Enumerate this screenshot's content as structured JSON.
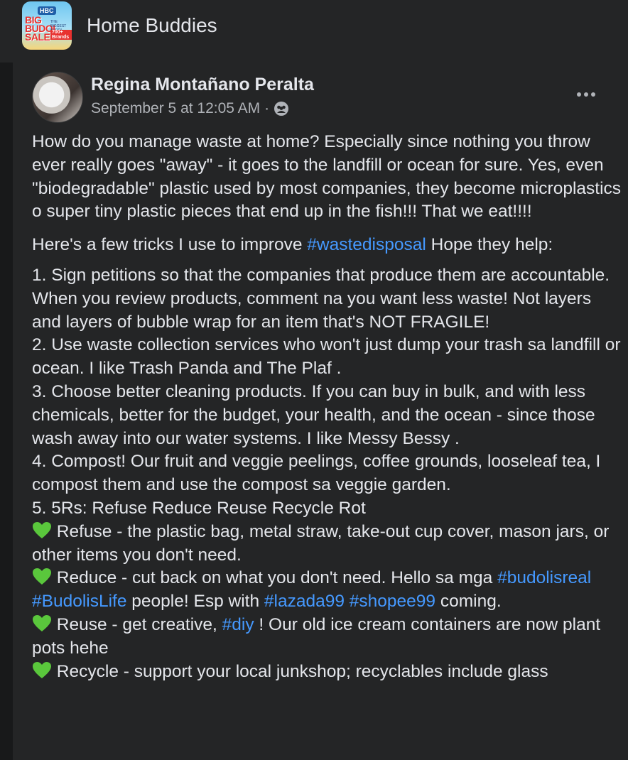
{
  "group": {
    "name": "Home Buddies",
    "thumbnail": {
      "logo": "HBC",
      "title": "BIG BUDOL SALE",
      "subtitle": "THE BIGGEST BUDOL SALE",
      "brands": "700+ Brands"
    }
  },
  "post": {
    "author": "Regina Montañano Peralta",
    "timestamp": "September 5 at 12:05 AM",
    "separator": "·",
    "audience_icon": "group-audience-icon",
    "more_icon": "more-options-icon",
    "intro": "How do you manage waste at home? Especially since nothing you throw ever really goes \"away\" - it goes to the landfill or ocean for sure. Yes, even \"biodegradable\" plastic used by most companies, they become microplastics o super tiny plastic pieces that end up in the fish!!! That we eat!!!!",
    "tricks_pre": "Here's a few tricks I use to improve ",
    "tricks_tag": "#wastedisposal",
    "tricks_post": "  Hope they help:",
    "item1": "1. Sign petitions so that the companies that produce them are accountable. When you review products, comment na you want less waste! Not layers and layers of bubble wrap for an item that's NOT FRAGILE!",
    "item2": "2. Use waste collection services who won't just dump your trash sa landfill or ocean. I like Trash Panda and The Plaf .",
    "item3": "3. Choose better cleaning products. If you can buy in bulk, and with less chemicals, better for the budget, your health, and the ocean - since those wash away into our water systems. I like Messy Bessy .",
    "item4": "4. Compost! Our fruit and veggie peelings, coffee grounds, looseleaf tea, I compost them and use the compost sa veggie garden.",
    "item5": "5. 5Rs: Refuse Reduce Reuse Recycle Rot",
    "refuse": " Refuse - the plastic bag, metal straw, take-out cup cover, mason jars, or other items you don't need.",
    "reduce_pre": " Reduce - cut back on what you don't need. Hello sa mga ",
    "reduce_tag1": "#budolisreal",
    "reduce_tag2": "#BudolisLife",
    "reduce_mid": " people! Esp with ",
    "reduce_tag3": "#lazada99",
    "reduce_tag4": "#shopee99",
    "reduce_post": " coming.",
    "reuse_pre": " Reuse - get creative, ",
    "reuse_tag": "#diy",
    "reuse_post": " ! Our old ice cream containers are now plant pots hehe",
    "recycle": " Recycle - support your local junkshop; recyclables include glass"
  },
  "colors": {
    "background": "#242526",
    "text": "#e4e6eb",
    "secondary": "#b0b3b8",
    "hashtag": "#4599ff",
    "heart": "#5ac73c"
  }
}
